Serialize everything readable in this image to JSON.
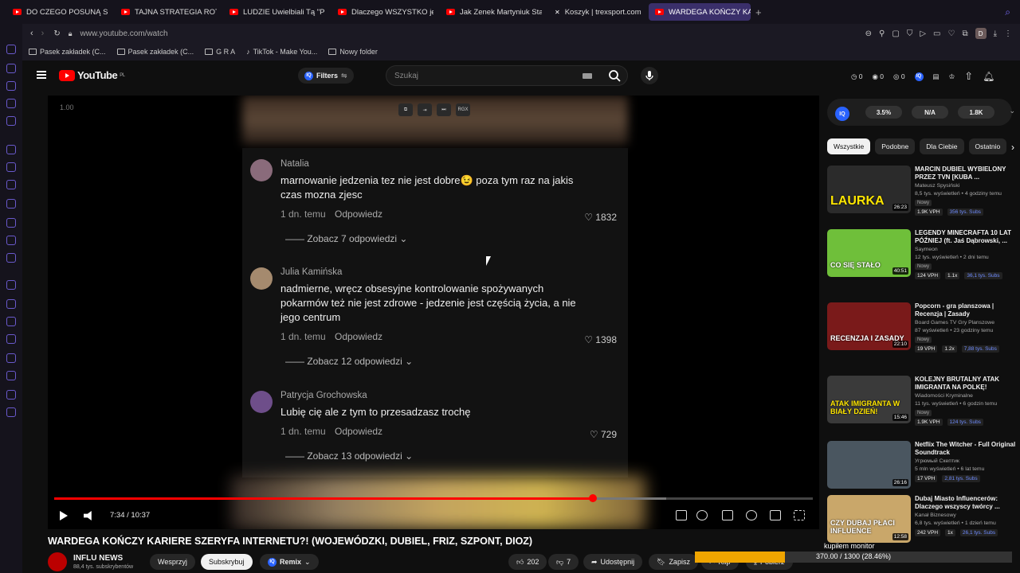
{
  "browser": {
    "tabs": [
      {
        "label": "DO CZEGO POSUNĄ SIĘ K",
        "icon": "youtube-icon"
      },
      {
        "label": "TAJNA STRATEGIA ROTHS",
        "icon": "youtube-icon"
      },
      {
        "label": "LUDZIE Uwielbiali Tą \"Prze",
        "icon": "youtube-icon"
      },
      {
        "label": "Dlaczego WSZYSTKO jest",
        "icon": "youtube-icon"
      },
      {
        "label": "Jak Zenek Martyniuk Stał",
        "icon": "youtube-icon"
      },
      {
        "label": "Koszyk | trexsport.com",
        "icon": "trex-icon"
      },
      {
        "label": "WARDEGA KOŃCZY KARIE",
        "icon": "youtube-icon",
        "active": true
      }
    ],
    "url": "www.youtube.com/watch",
    "profile_initial": "D",
    "bookmarks": [
      "Pasek zakładek (C...",
      "Pasek zakładek (C...",
      "G R A",
      "TikTok - Make You...",
      "Nowy folder"
    ]
  },
  "youtube": {
    "logo_text": "YouTube",
    "logo_region": "PL",
    "filters_label": "Filters",
    "search_placeholder": "Szukaj",
    "header_counts": [
      "0",
      "0",
      "0"
    ]
  },
  "player": {
    "speed_label": "1.00",
    "top_icon_label": "RGX",
    "time": "7:34 / 10:37",
    "progress_played_fraction": 0.71,
    "progress_buffered_fraction": 0.807,
    "comments": [
      {
        "author": "Natalia",
        "text": "marnowanie jedzenia tez nie jest dobre😉 poza tym raz na jakis czas mozna zjesc",
        "time": "1 dn. temu",
        "reply": "Odpowiedz",
        "likes": "1832",
        "more": "Zobacz 7 odpowiedzi"
      },
      {
        "author": "Julia Kamińska",
        "text": "nadmierne, wręcz obsesyjne kontrolowanie spożywanych pokarmów też nie jest zdrowe - jedzenie jest częścią życia, a nie jego centrum",
        "time": "1 dn. temu",
        "reply": "Odpowiedz",
        "likes": "1398",
        "more": "Zobacz 12 odpowiedzi"
      },
      {
        "author": "Patrycja Grochowska",
        "text": "Lubię cię ale z tym to przesadzasz trochę",
        "time": "1 dn. temu",
        "reply": "Odpowiedz",
        "likes": "729",
        "more": "Zobacz 13 odpowiedzi"
      }
    ]
  },
  "video": {
    "title": "WARDEGA KOŃCZY KARIERE SZERYFA INTERNETU?! (WOJEWÓDZKI, DUBIEL, FRIZ, SZPONT, DIOZ)",
    "channel": "INFLU NEWS",
    "subs": "88,4 tys. subskrybentów",
    "support": "Wesprzyj",
    "subscribe": "Subskrybuj",
    "remix": "Remix",
    "likes": "202",
    "dislikes": "7",
    "share": "Udostępnij",
    "save": "Zapisz",
    "clip": "Klip",
    "download": "Pobierz"
  },
  "iq_stats": [
    "3.5%",
    "N/A",
    "1.8K"
  ],
  "sidebar": {
    "chips": [
      "Wszystkie",
      "Podobne",
      "Dla Ciebie",
      "Ostatnio"
    ],
    "recs": [
      {
        "title": "MARCIN DUBIEL WYBIELONY PRZEZ TVN [KUBA ...",
        "channel": "Mateusz Spysiński",
        "meta": "8,5 tys. wyświetleń • 4 godziny temu",
        "badge": "Nowy",
        "vph": "1.9K VPH",
        "ratio": "",
        "subs": "356 tys. Subs",
        "dur": "26:23",
        "thumb": "#2b2b2b",
        "overlay": "LAURKA"
      },
      {
        "title": "LEGENDY MINECRAFTA 10 LAT PÓŹNIEJ (ft. Jaś Dąbrowski, ...",
        "channel": "Saymeon",
        "meta": "12 tys. wyświetleń • 2 dni temu",
        "badge": "Nowy",
        "vph": "124 VPH",
        "ratio": "1.1x",
        "subs": "36,1 tys. Subs",
        "dur": "40:51",
        "thumb": "#6fbf3a",
        "overlay": "CO SIĘ STAŁO"
      },
      {
        "title": "Popcorn - gra planszowa | Recenzja | Zasady",
        "channel": "Board Games TV Gry Planszowe",
        "meta": "87 wyświetleń • 23 godziny temu",
        "badge": "Nowy",
        "vph": "19 VPH",
        "ratio": "1.2x",
        "subs": "7,88 tys. Subs",
        "dur": "22:10",
        "thumb": "#7a1a1a",
        "overlay": "RECENZJA I ZASADY"
      },
      {
        "title": "KOLEJNY BRUTALNY ATAK IMIGRANTA NA POLKĘ!",
        "channel": "Wiadomości Kryminalne",
        "meta": "11 tys. wyświetleń • 6 godzin temu",
        "badge": "Nowy",
        "vph": "1.9K VPH",
        "ratio": "",
        "subs": "124 tys. Subs",
        "dur": "15:46",
        "thumb": "#3a3a3a",
        "overlay": "ATAK IMIGRANTA W BIAŁY DZIEŃ!"
      },
      {
        "title": "Netflix The Witcher - Full Original Soundtrack",
        "channel": "Угрюмый Скептик",
        "meta": "5 mln wyświetleń • 6 lat temu",
        "badge": "",
        "vph": "17 VPH",
        "ratio": "",
        "subs": "2,81 tys. Subs",
        "dur": "26:16",
        "thumb": "#4a5660",
        "overlay": ""
      },
      {
        "title": "Dubaj Miasto Influencerów: Dlaczego wszyscy twórcy ...",
        "channel": "Kanał Biznesowy",
        "meta": "6,8 tys. wyświetleń • 1 dzień temu",
        "badge": "",
        "vph": "242 VPH",
        "ratio": "1x",
        "subs": "26,1 tys. Subs",
        "dur": "12:58",
        "thumb": "#c9a76a",
        "overlay": "CZY DUBAJ PŁACI INFLUENCE"
      }
    ]
  },
  "download": {
    "label": "kupiłem monitor",
    "progress_text": "370.00 / 1300 (28.46%)",
    "fraction": 0.2846
  }
}
